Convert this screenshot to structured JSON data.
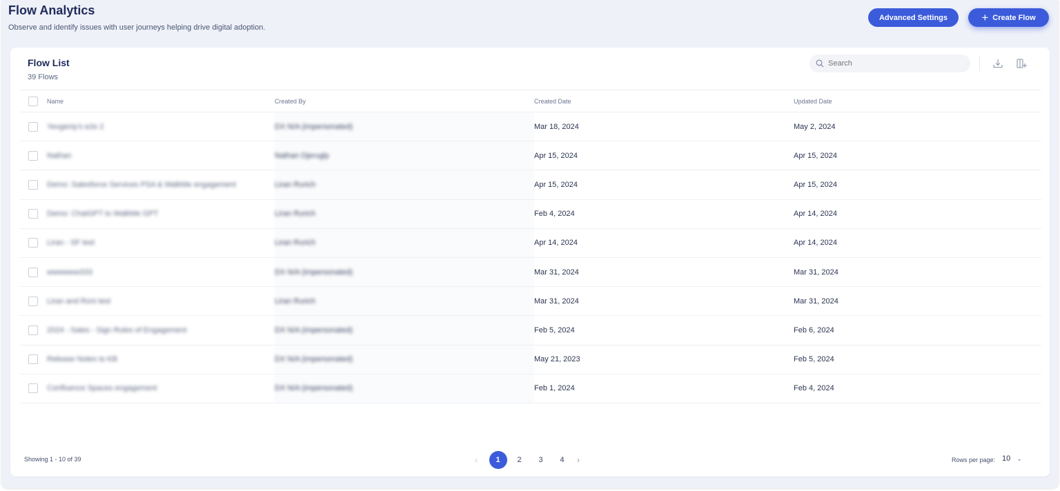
{
  "header": {
    "title": "Flow Analytics",
    "subtitle": "Observe and identify issues with user journeys helping drive digital adoption.",
    "advanced_settings_label": "Advanced Settings",
    "create_flow_label": "Create Flow"
  },
  "list": {
    "title": "Flow List",
    "count": "39 Flows",
    "search_placeholder": "Search",
    "columns": [
      "Name",
      "Created By",
      "Created Date",
      "Updated Date"
    ],
    "rows": [
      {
        "name": "Yevgeniy's e2e 2",
        "created_by": "DX N/A (impersonated)",
        "created_date": "Mar 18, 2024",
        "updated_date": "May 2, 2024"
      },
      {
        "name": "Nathan",
        "created_by": "Nathan Djerugly",
        "created_date": "Apr 15, 2024",
        "updated_date": "Apr 15, 2024"
      },
      {
        "name": "Demo: Salesforce Services PSA & WalkMe engagement",
        "created_by": "Liran Rurich",
        "created_date": "Apr 15, 2024",
        "updated_date": "Apr 15, 2024"
      },
      {
        "name": "Demo: ChatGPT to WalkMe GPT",
        "created_by": "Liran Rurich",
        "created_date": "Feb 4, 2024",
        "updated_date": "Apr 14, 2024"
      },
      {
        "name": "Liran - SF test",
        "created_by": "Liran Rurich",
        "created_date": "Apr 14, 2024",
        "updated_date": "Apr 14, 2024"
      },
      {
        "name": "wwwwww333",
        "created_by": "DX N/A (impersonated)",
        "created_date": "Mar 31, 2024",
        "updated_date": "Mar 31, 2024"
      },
      {
        "name": "Liran and Roni test",
        "created_by": "Liran Rurich",
        "created_date": "Mar 31, 2024",
        "updated_date": "Mar 31, 2024"
      },
      {
        "name": "2024 - Sales - Sign Rules of Engagement",
        "created_by": "DX N/A (impersonated)",
        "created_date": "Feb 5, 2024",
        "updated_date": "Feb 6, 2024"
      },
      {
        "name": "Release Notes to KB",
        "created_by": "DX N/A (impersonated)",
        "created_date": "May 21, 2023",
        "updated_date": "Feb 5, 2024"
      },
      {
        "name": "Confluence Spaces engagement",
        "created_by": "DX N/A (impersonated)",
        "created_date": "Feb 1, 2024",
        "updated_date": "Feb 4, 2024"
      }
    ]
  },
  "footer": {
    "showing": "Showing 1 - 10 of 39",
    "pages": [
      "1",
      "2",
      "3",
      "4"
    ],
    "current_page": "1",
    "prev_icon": "chevron-left-icon",
    "next_icon": "chevron-right-icon",
    "rows_per_page_label": "Rows per page:",
    "rows_per_page_value": "10"
  },
  "colors": {
    "accent": "#3b5bdb",
    "background": "#eef1f8"
  }
}
